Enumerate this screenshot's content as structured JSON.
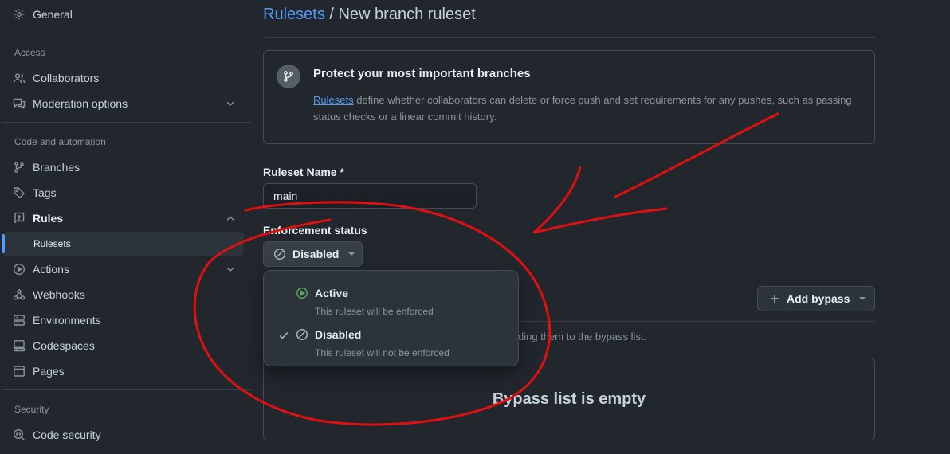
{
  "sidebar": {
    "general": "General",
    "access_label": "Access",
    "collaborators": "Collaborators",
    "moderation": "Moderation options",
    "code_automation_label": "Code and automation",
    "branches": "Branches",
    "tags": "Tags",
    "rules": "Rules",
    "rulesets": "Rulesets",
    "actions": "Actions",
    "webhooks": "Webhooks",
    "environments": "Environments",
    "codespaces": "Codespaces",
    "pages": "Pages",
    "security_label": "Security",
    "code_security": "Code security"
  },
  "breadcrumb": {
    "link": "Rulesets",
    "separator": " / ",
    "current": "New branch ruleset"
  },
  "info": {
    "title": "Protect your most important branches",
    "link": "Rulesets",
    "description": " define whether collaborators can delete or force push and set requirements for any pushes, such as passing status checks or a linear commit history."
  },
  "form": {
    "name_label": "Ruleset Name *",
    "name_value": "main",
    "enforcement_label": "Enforcement status",
    "enforcement_value": "Disabled"
  },
  "dropdown": {
    "options": [
      {
        "title": "Active",
        "desc": "This ruleset will be enforced",
        "selected": false
      },
      {
        "title": "Disabled",
        "desc": "This ruleset will not be enforced",
        "selected": true
      }
    ]
  },
  "bypass": {
    "button": "Add bypass",
    "help_visible": "ding them to the bypass list.",
    "empty": "Bypass list is empty"
  },
  "colors": {
    "accent": "#539bf5",
    "active_icon": "#57ab5a",
    "annotation": "#e01010"
  }
}
